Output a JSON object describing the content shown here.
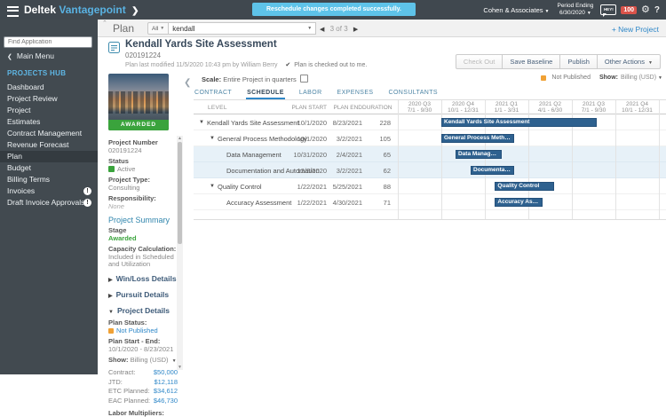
{
  "icons": {
    "caret_down": "▼",
    "caret_right": "▶",
    "chevron_left": "❮",
    "chevron_right": "❯",
    "chevron_up": "⌃",
    "prev": "◀",
    "next": "▶",
    "check": "✔",
    "gear": "⚙",
    "help": "?",
    "badge_excl": "!",
    "scroll_up": "▲",
    "scroll_down": "▼"
  },
  "colors": {
    "accent_blue": "#2e87c8",
    "bar_blue": "#2e618f",
    "highlight_row": "#e7f1f8",
    "status_green": "#3aa33c",
    "status_orange": "#f0a135",
    "banner_blue": "#5ec3e9",
    "badge_red": "#d9534a"
  },
  "topbar": {
    "brand_deltek": "Deltek",
    "brand_product": "Vantagepoint",
    "banner": "Reschedule changes completed successfully.",
    "company": "Cohen & Associates",
    "period_label": "Period Ending",
    "period_value": "6/30/2020",
    "assistant_label": "HEY!",
    "notification_count": "100"
  },
  "toolbar": {
    "page_title": "Plan",
    "filter_label": "All",
    "search_value": "kendall",
    "pager_text": "3 of 3",
    "new_project_label": "+ New Project"
  },
  "sidebar": {
    "find_placeholder": "Find Application",
    "main_menu": "Main Menu",
    "section": "PROJECTS HUB",
    "items": [
      {
        "label": "Dashboard"
      },
      {
        "label": "Project Review"
      },
      {
        "label": "Project"
      },
      {
        "label": "Estimates"
      },
      {
        "label": "Contract Management"
      },
      {
        "label": "Revenue Forecast"
      },
      {
        "label": "Plan",
        "selected": true
      },
      {
        "label": "Budget"
      },
      {
        "label": "Billing Terms"
      },
      {
        "label": "Invoices",
        "badge": "!"
      },
      {
        "label": "Draft Invoice Approvals",
        "badge": "!"
      }
    ]
  },
  "header": {
    "title": "Kendall Yards Site Assessment",
    "number": "020191224",
    "modified": "Plan last modified 11/5/2020 10:43 pm by William Berry",
    "checked_out_note": "Plan is checked out to me.",
    "buttons": {
      "check_out": "Check Out",
      "save_baseline": "Save Baseline",
      "publish": "Publish",
      "other_actions": "Other Actions"
    }
  },
  "panel": {
    "awarded_banner": "AWARDED",
    "project_number_label": "Project Number",
    "project_number": "020191224",
    "status_label": "Status",
    "status_value": "Active",
    "type_label": "Project Type:",
    "type_value": "Consulting",
    "resp_label": "Responsibility:",
    "resp_value": "None",
    "summary_title": "Project Summary",
    "stage_label": "Stage",
    "stage_value": "Awarded",
    "capacity_label": "Capacity Calculation:",
    "capacity_value": "Included in Scheduled and Utilization",
    "sections": [
      {
        "label": "Win/Loss Details",
        "expanded": false
      },
      {
        "label": "Pursuit Details",
        "expanded": false
      },
      {
        "label": "Project Details",
        "expanded": true
      }
    ],
    "plan_status_label": "Plan Status:",
    "plan_status_value": "Not Published",
    "plan_range_label": "Plan Start - End:",
    "plan_range_value": "10/1/2020 - 8/23/2021",
    "show_label": "Show:",
    "show_value": "Billing (USD)",
    "amounts": [
      {
        "label": "Contract:",
        "value": "$50,000"
      },
      {
        "label": "JTD:",
        "value": "$12,118"
      },
      {
        "label": "ETC Planned:",
        "value": "$34,612"
      },
      {
        "label": "EAC Planned:",
        "value": "$46,730"
      }
    ],
    "labor_label": "Labor Multipliers:"
  },
  "gantt": {
    "scale_label": "Scale:",
    "scale_value": "Entire Project in quarters",
    "plan_status": "Not Published",
    "show_label": "Show:",
    "show_value": "Billing (USD)",
    "tabs": [
      {
        "label": "CONTRACT",
        "active": false
      },
      {
        "label": "SCHEDULE",
        "active": true
      },
      {
        "label": "LABOR",
        "active": false
      },
      {
        "label": "EXPENSES",
        "active": false
      },
      {
        "label": "CONSULTANTS",
        "active": false
      }
    ],
    "columns": {
      "level": "LEVEL",
      "start": "PLAN START",
      "end": "PLAN END",
      "duration": "DURATION"
    },
    "timeline_start": "7/1/2020",
    "quarter_count": 6,
    "quarters": [
      {
        "label": "2020 Q3",
        "range": "7/1 - 9/30"
      },
      {
        "label": "2020 Q4",
        "range": "10/1 - 12/31"
      },
      {
        "label": "2021 Q1",
        "range": "1/1 - 3/31"
      },
      {
        "label": "2021 Q2",
        "range": "4/1 - 6/30"
      },
      {
        "label": "2021 Q3",
        "range": "7/1 - 9/30"
      },
      {
        "label": "2021 Q4",
        "range": "10/1 - 12/31"
      }
    ],
    "rows": [
      {
        "name": "Kendall Yards Site Assessment",
        "level": 0,
        "expandable": true,
        "start": "10/1/2020",
        "end": "8/23/2021",
        "duration": "228",
        "highlight": false
      },
      {
        "name": "General Process Methodology",
        "level": 1,
        "expandable": true,
        "start": "10/1/2020",
        "end": "3/2/2021",
        "duration": "105",
        "highlight": false
      },
      {
        "name": "Data Management",
        "level": 2,
        "expandable": false,
        "start": "10/31/2020",
        "end": "2/4/2021",
        "duration": "65",
        "highlight": true
      },
      {
        "name": "Documentation and Automation",
        "level": 2,
        "expandable": false,
        "start": "12/2/2020",
        "end": "3/2/2021",
        "duration": "62",
        "highlight": true
      },
      {
        "name": "Quality Control",
        "level": 1,
        "expandable": true,
        "start": "1/22/2021",
        "end": "5/25/2021",
        "duration": "88",
        "highlight": false
      },
      {
        "name": "Accuracy Assessment",
        "level": 2,
        "expandable": false,
        "start": "1/22/2021",
        "end": "4/30/2021",
        "duration": "71",
        "highlight": false
      }
    ]
  }
}
